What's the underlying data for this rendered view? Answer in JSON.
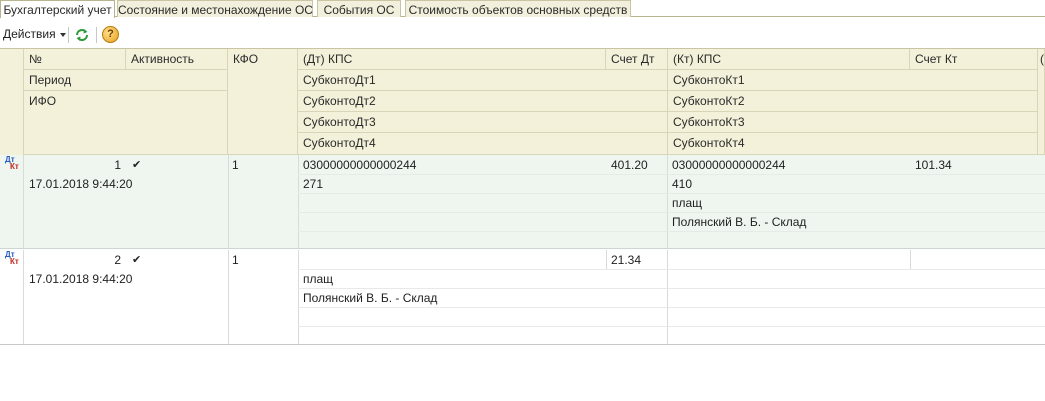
{
  "tabs": [
    {
      "label": "Бухгалтерский учет",
      "active": true
    },
    {
      "label": "Состояние и местонахождение ОС",
      "active": false
    },
    {
      "label": "События ОС",
      "active": false
    },
    {
      "label": "Стоимость объектов основных средств",
      "active": false
    }
  ],
  "toolbar": {
    "actions_label": "Действия",
    "refresh_icon": "refresh-icon",
    "help_icon": "help-icon",
    "help_glyph": "?"
  },
  "grid": {
    "headers": {
      "num": "№",
      "activity": "Активность",
      "period": "Период",
      "ifo": "ИФО",
      "kfo": "КФО",
      "dt_kps": "(Дт) КПС",
      "schet_dt": "Счет Дт",
      "subkonto_dt": [
        "СубконтоДт1",
        "СубконтоДт2",
        "СубконтоДт3",
        "СубконтоДт4"
      ],
      "kt_kps": "(Кт) КПС",
      "schet_kt": "Счет Кт",
      "subkonto_kt": [
        "СубконтоКт1",
        "СубконтоКт2",
        "СубконтоКт3",
        "СубконтоКт4"
      ],
      "extra_partial": "("
    },
    "rows": [
      {
        "dt_mark": "Дт",
        "kt_mark": "Кт",
        "num": "1",
        "active": "✔",
        "period": "17.01.2018 9:44:20",
        "kfo": "1",
        "dt_kps": "03000000000000244",
        "schet_dt": "401.20",
        "subkonto_dt": [
          "271",
          "",
          "",
          ""
        ],
        "kt_kps": "03000000000000244",
        "schet_kt": "101.34",
        "subkonto_kt": [
          "410",
          "плащ",
          "Полянский В. Б. - Склад",
          ""
        ]
      },
      {
        "dt_mark": "Дт",
        "kt_mark": "Кт",
        "num": "2",
        "active": "✔",
        "period": "17.01.2018 9:44:20",
        "kfo": "1",
        "dt_kps": "",
        "schet_dt": "21.34",
        "subkonto_dt": [
          "",
          "плащ",
          "Полянский В. Б. - Склад",
          ""
        ],
        "kt_kps": "",
        "schet_kt": "",
        "subkonto_kt": [
          "",
          "",
          "",
          ""
        ]
      }
    ]
  }
}
